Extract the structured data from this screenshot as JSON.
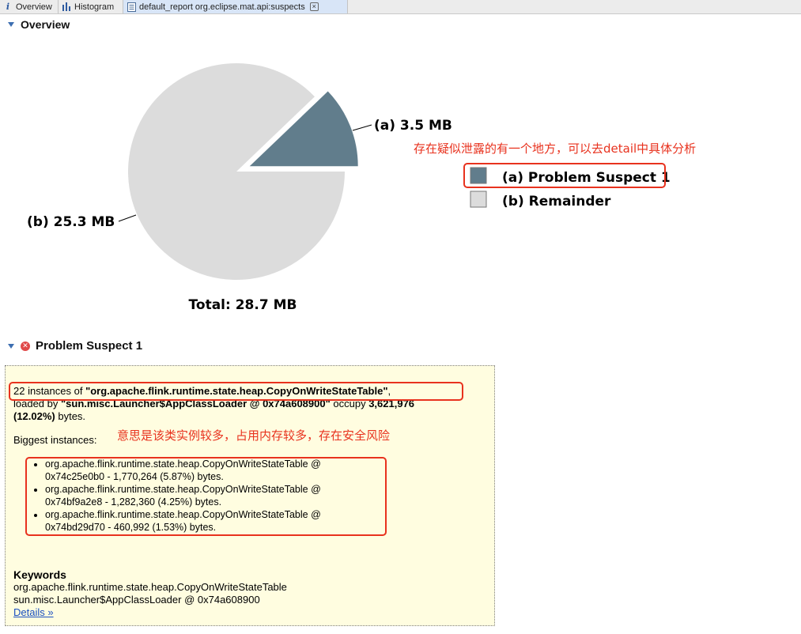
{
  "tabs": [
    {
      "label": "Overview",
      "icon": "info-icon",
      "active": false
    },
    {
      "label": "Histogram",
      "icon": "histogram-icon",
      "active": false
    },
    {
      "label": "default_report  org.eclipse.mat.api:suspects",
      "icon": "report-icon",
      "active": true
    }
  ],
  "overview": {
    "title": "Overview"
  },
  "chart_data": {
    "type": "pie",
    "total_label": "Total: 28.7 MB",
    "slices": [
      {
        "label": "(a)  3.5 MB",
        "legend": "(a)  Problem Suspect 1",
        "value_mb": 3.5,
        "color": "#617d8c"
      },
      {
        "label": "(b)  25.3 MB",
        "legend": "(b)  Remainder",
        "value_mb": 25.3,
        "color": "#dcdcdc"
      }
    ]
  },
  "annotations": {
    "chart_note": "存在疑似泄露的有一个地方，可以去detail中具体分析",
    "suspect_note": "意思是该类实例较多，占用内存较多，存在安全风险"
  },
  "suspect": {
    "title": "Problem Suspect 1",
    "line1_prefix": "22 instances of ",
    "line1_class": "\"org.apache.flink.runtime.state.heap.CopyOnWriteStateTable\"",
    "line1_suffix": ",",
    "line2_prefix": "loaded by ",
    "line2_loader": "\"sun.misc.Launcher$AppClassLoader @ 0x74a608900\"",
    "line2_mid": " occupy ",
    "line2_bytes": "3,621,976",
    "line3_pct": "(12.02%)",
    "line3_suffix": " bytes.",
    "biggest_label": "Biggest instances:",
    "instances": [
      {
        "line1": "org.apache.flink.runtime.state.heap.CopyOnWriteStateTable @",
        "line2": "0x74c25e0b0 - 1,770,264 (5.87%) bytes."
      },
      {
        "line1": "org.apache.flink.runtime.state.heap.CopyOnWriteStateTable @",
        "line2": "0x74bf9a2e8 - 1,282,360 (4.25%) bytes."
      },
      {
        "line1": "org.apache.flink.runtime.state.heap.CopyOnWriteStateTable @",
        "line2": "0x74bd29d70 - 460,992 (1.53%) bytes."
      }
    ],
    "keywords_title": "Keywords",
    "keywords": [
      "org.apache.flink.runtime.state.heap.CopyOnWriteStateTable",
      "sun.misc.Launcher$AppClassLoader @ 0x74a608900"
    ],
    "details_link": "Details »"
  }
}
